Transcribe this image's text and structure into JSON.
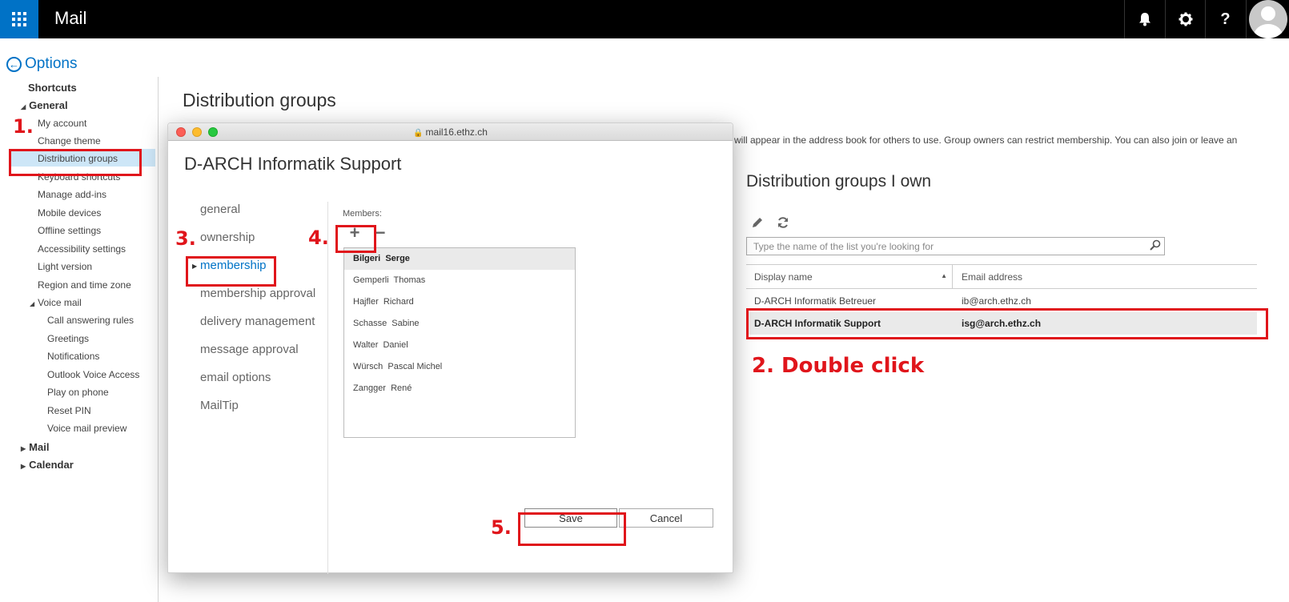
{
  "app": {
    "title": "Mail"
  },
  "topbar": {
    "help_label": "?"
  },
  "options": {
    "back_label": "Options"
  },
  "leftnav": {
    "shortcuts": "Shortcuts",
    "general": "General",
    "items": [
      "My account",
      "Change theme",
      "Distribution groups",
      "Keyboard shortcuts",
      "Manage add-ins",
      "Mobile devices",
      "Offline settings",
      "Accessibility settings",
      "Light version",
      "Region and time zone"
    ],
    "voice_mail": "Voice mail",
    "voice_items": [
      "Call answering rules",
      "Greetings",
      "Notifications",
      "Outlook Voice Access",
      "Play on phone",
      "Reset PIN",
      "Voice mail preview"
    ],
    "mail": "Mail",
    "calendar": "Calendar"
  },
  "page": {
    "title": "Distribution groups",
    "intro": "will appear in the address book for others to use. Group owners can restrict membership. You can also join or leave an",
    "own_title": "Distribution groups I own",
    "search_placeholder": "Type the name of the list you're looking for",
    "columns": {
      "display_name": "Display name",
      "email": "Email address"
    },
    "rows": [
      {
        "name": "D-ARCH Informatik Betreuer",
        "email": "ib@arch.ethz.ch"
      },
      {
        "name": "D-ARCH Informatik Support",
        "email": "isg@arch.ethz.ch"
      }
    ]
  },
  "dialog": {
    "url": "mail16.ethz.ch",
    "title": "D-ARCH Informatik Support",
    "nav": [
      "general",
      "ownership",
      "membership",
      "membership approval",
      "delivery management",
      "message approval",
      "email options",
      "MailTip"
    ],
    "members_label": "Members:",
    "add_symbol": "+",
    "remove_symbol": "−",
    "members": [
      "Bilgeri  Serge",
      "Gemperli  Thomas",
      "Hajfler  Richard",
      "Schasse  Sabine",
      "Walter  Daniel",
      "Würsch  Pascal Michel",
      "Zangger  René"
    ],
    "save": "Save",
    "cancel": "Cancel"
  },
  "annotations": {
    "step1": "1.",
    "step2": "2. Double click",
    "step3": "3.",
    "step4": "4.",
    "step5": "5."
  },
  "colors": {
    "accent": "#0072c6",
    "annotation": "#e0151b",
    "topbar": "#000000"
  }
}
